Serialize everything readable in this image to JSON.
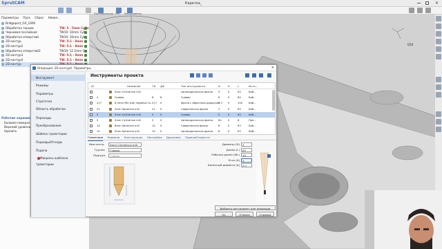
{
  "app": {
    "logo": "SprutCAM",
    "document_title": "Каретка_"
  },
  "ribbon": {
    "top_button_labels": [
      "Постпроцессор",
      "FPK",
      "Инструменты"
    ]
  },
  "tree_toolbar": {
    "items": [
      "Параметры",
      "Пуск",
      "Сброс",
      "Новая..."
    ]
  },
  "tree": [
    {
      "label": "Bridgeport_GX_1000",
      "tool": "",
      "red": false,
      "check": false,
      "selected": false
    },
    {
      "label": "Обработка торцев",
      "tool": "TW: 5 - 5mm Cylin",
      "red": true,
      "check": true,
      "selected": false
    },
    {
      "label": "Черновая послойная",
      "tool": "TW10: 10mm Cylin",
      "red": false,
      "check": true,
      "selected": false
    },
    {
      "label": "Обработка отверстий",
      "tool": "TW10: 10mm Cylin",
      "red": false,
      "check": true,
      "selected": false
    },
    {
      "label": "2D контур",
      "tool": "TW: 5:1 - 8mm",
      "red": true,
      "check": true,
      "selected": false
    },
    {
      "label": "2D контур2",
      "tool": "TW: 5:1 - 8mm",
      "red": true,
      "check": true,
      "selected": false
    },
    {
      "label": "Обработка отверстий2",
      "tool": "TW19: 12 2mm Cy",
      "red": false,
      "check": true,
      "selected": false
    },
    {
      "label": "2D контур3",
      "tool": "TW: 5:1 - 8mm",
      "red": true,
      "check": true,
      "selected": false
    },
    {
      "label": "2D контур4",
      "tool": "TW: 5:1 - 8mm",
      "red": true,
      "check": true,
      "selected": false
    },
    {
      "label": "2D контур",
      "tool": "TW: 5:1 - 8mm",
      "red": true,
      "check": true,
      "selected": true
    }
  ],
  "work_panel": {
    "title": "Рабочие задания",
    "items": [
      "Базовая поверхн",
      "Верхний уровень",
      "Удалить"
    ]
  },
  "viewport": {
    "axis_label": "G54"
  },
  "dialog": {
    "title": "Операция: 2D контур4. Параметры",
    "close": "×",
    "sidebar": [
      {
        "label": "Инструмент",
        "selected": true
      },
      {
        "label": "Режимы",
        "selected": false
      },
      {
        "label": "Параметры",
        "selected": false
      },
      {
        "label": "Стратегия",
        "selected": false
      },
      {
        "label": "Область обработки",
        "selected": false
      },
      {
        "label": "Переходы",
        "selected": false
      },
      {
        "label": "Преобразования",
        "selected": false
      },
      {
        "label": "Шаблон траектории",
        "selected": false
      },
      {
        "label": "Подходы/Отходы",
        "selected": false
      },
      {
        "label": "Подачи",
        "selected": false
      },
      {
        "label": "Макросы шаблона траектории",
        "selected": false
      }
    ],
    "section_title": "Инструменты проекта",
    "columns": [
      "ID",
      "",
      "Название",
      "Т#",
      "Д#",
      "Тип инструмента",
      "D",
      "R",
      "L",
      "Исто..."
    ],
    "rows": [
      {
        "id": "",
        "t": "",
        "d": "",
        "name": "5mm Cylindrical mill",
        "type": "Цилиндрическая фреза",
        "D": "5",
        "R": "0",
        "L": "63",
        "src": "Биб...",
        "sel": false
      },
      {
        "id": "4",
        "t": "8",
        "d": "8",
        "name": "Гравер",
        "type": "Гравер",
        "D": "6",
        "R": "0",
        "L": "84",
        "src": "Биб...",
        "sel": false
      },
      {
        "id": "217",
        "t": "217",
        "d": "0",
        "name": "6,3mm Mill with negative ra...",
        "type": "Фреза с обратным радиусом",
        "D": "6,3",
        "R": "0",
        "L": "100",
        "src": "Биб...",
        "sel": false
      },
      {
        "id": "21",
        "t": "21",
        "d": "0",
        "name": "3mm Spherical mill",
        "type": "Сферическая фреза",
        "D": "3",
        "R": "0",
        "L": "63",
        "src": "Биб...",
        "sel": false
      },
      {
        "id": "5",
        "t": "5",
        "d": "0",
        "name": "5mm Cylindrical mill",
        "type": "Гравер",
        "D": "5",
        "R": "0",
        "L": "63",
        "src": "Биб...",
        "sel": true
      },
      {
        "id": "5",
        "t": "5",
        "d": "0",
        "name": "5mm Cylindrical mill",
        "type": "Цилиндрическая фреза",
        "D": "64",
        "R": "0",
        "L": "8",
        "src": "Про...",
        "sel": false
      },
      {
        "id": "14",
        "t": "14",
        "d": "0",
        "name": "8mm Spherical mill",
        "type": "Сферическая фреза",
        "D": "8",
        "R": "0",
        "L": "63",
        "src": "Биб...",
        "sel": false
      },
      {
        "id": "10",
        "t": "10",
        "d": "0",
        "name": "5mm Spherical mill",
        "type": "Цилиндрическая фреза",
        "D": "8",
        "R": "0",
        "L": "63",
        "src": "Биб...",
        "sel": false
      },
      {
        "id": "12",
        "t": "12",
        "d": "0",
        "name": "12mm Cylindrical mill",
        "type": "Цилиндрическая фреза",
        "D": "12",
        "R": "0",
        "L": "63",
        "src": "Биб...",
        "sel": false
      }
    ],
    "subtabs": [
      "Геометрия",
      "Нормали",
      "Конструкция",
      "Настройка",
      "Державка",
      "Подачи/Скорости"
    ],
    "name_label": "Имя инстр.",
    "name_value": "5mm Cylindrical mill",
    "group_label": "Группа",
    "group_value": "Гравер",
    "subgroup_label": "Подгруп.",
    "subgroup_value": "Гравер",
    "params": [
      {
        "label": "Диаметр (D)",
        "value": "5"
      },
      {
        "label": "Длина (L)",
        "value": "63"
      },
      {
        "label": "Рабочая длина (WL)",
        "value": "20"
      },
      {
        "label": "Угол (A)",
        "value": "5"
      },
      {
        "label": "Конечный диаметр (d)",
        "value": "0,1"
      }
    ],
    "pick_button": "Выбрать инструмент для операции",
    "ok": "Ок",
    "cancel": "Отмена",
    "help": "Справка"
  }
}
